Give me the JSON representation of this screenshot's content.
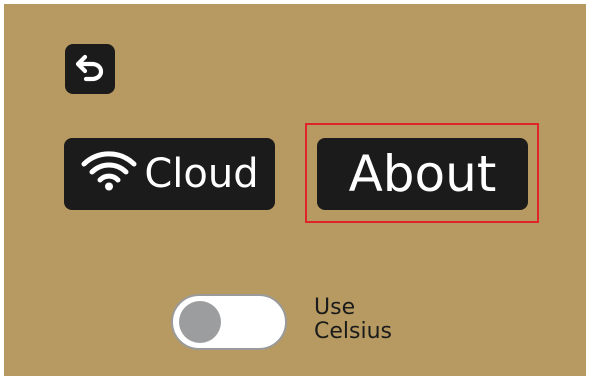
{
  "screen": {
    "background_color": "#b79a62",
    "button_color": "#1b1b1b",
    "highlight_color": "#e0242b"
  },
  "back_button": {
    "icon": "back-arrow-icon"
  },
  "menu": {
    "cloud": {
      "label": "Cloud",
      "icon": "wifi-icon"
    },
    "about": {
      "label": "About"
    }
  },
  "toggle": {
    "label_line1": "Use",
    "label_line2": "Celsius",
    "state": "off"
  }
}
